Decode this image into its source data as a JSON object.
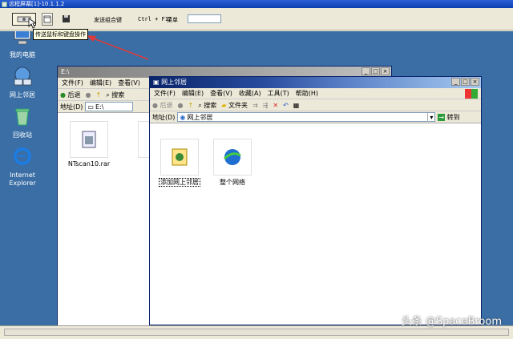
{
  "frame": {
    "title": "远程屏幕[1]-10.1.1.2"
  },
  "remote_toolbar": {
    "combo_label": "发送组合键",
    "ctrl_f12": "Ctrl + F12",
    "menu_label": "菜单",
    "tooltip": "传送鼠标和键盘操作"
  },
  "desktop": {
    "icons": [
      {
        "label": "我的电脑"
      },
      {
        "label": "网上邻居"
      },
      {
        "label": "回收站"
      },
      {
        "label": "Internet Explorer"
      }
    ]
  },
  "window_e": {
    "title": "E:\\",
    "menu": [
      "文件(F)",
      "编辑(E)",
      "查看(V)"
    ],
    "toolbar": {
      "back": "后退",
      "search": "搜索"
    },
    "address_label": "地址(D)",
    "address_value": "E:\\",
    "files": [
      {
        "name": "NTscan10.rar"
      }
    ]
  },
  "window_net": {
    "title": "网上邻居",
    "menu": [
      "文件(F)",
      "编辑(E)",
      "查看(V)",
      "收藏(A)",
      "工具(T)",
      "帮助(H)"
    ],
    "toolbar": {
      "back": "后退",
      "search": "搜索",
      "folders": "文件夹"
    },
    "address_label": "地址(D)",
    "address_value": "网上邻居",
    "go_label": "转到",
    "items": [
      {
        "name": "添加网上邻居"
      },
      {
        "name": "整个网络"
      }
    ]
  },
  "watermark": "头条 @SpaceBroom",
  "colors": {
    "desktop": "#3a6ea5",
    "title_active": "#0a246a",
    "arrow": "#e03a3a"
  }
}
